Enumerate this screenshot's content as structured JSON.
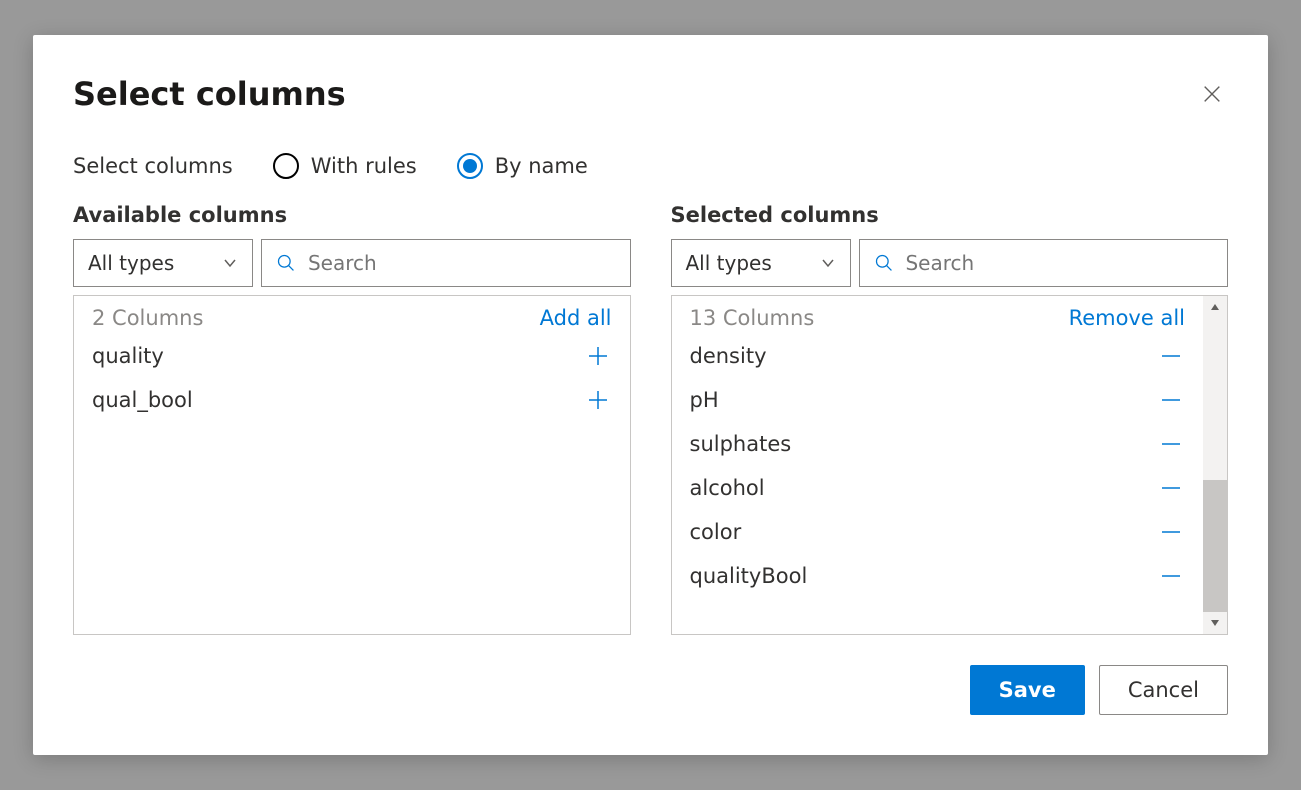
{
  "modal": {
    "title": "Select columns",
    "radio_label": "Select columns",
    "radio_options": {
      "with_rules": "With rules",
      "by_name": "By name"
    }
  },
  "available": {
    "title": "Available columns",
    "type_filter": "All types",
    "search_placeholder": "Search",
    "count": "2 Columns",
    "add_all": "Add all",
    "items": [
      "quality",
      "qual_bool"
    ]
  },
  "selected": {
    "title": "Selected columns",
    "type_filter": "All types",
    "search_placeholder": "Search",
    "count": "13 Columns",
    "remove_all": "Remove all",
    "items": [
      "density",
      "pH",
      "sulphates",
      "alcohol",
      "color",
      "qualityBool"
    ]
  },
  "footer": {
    "save": "Save",
    "cancel": "Cancel"
  }
}
